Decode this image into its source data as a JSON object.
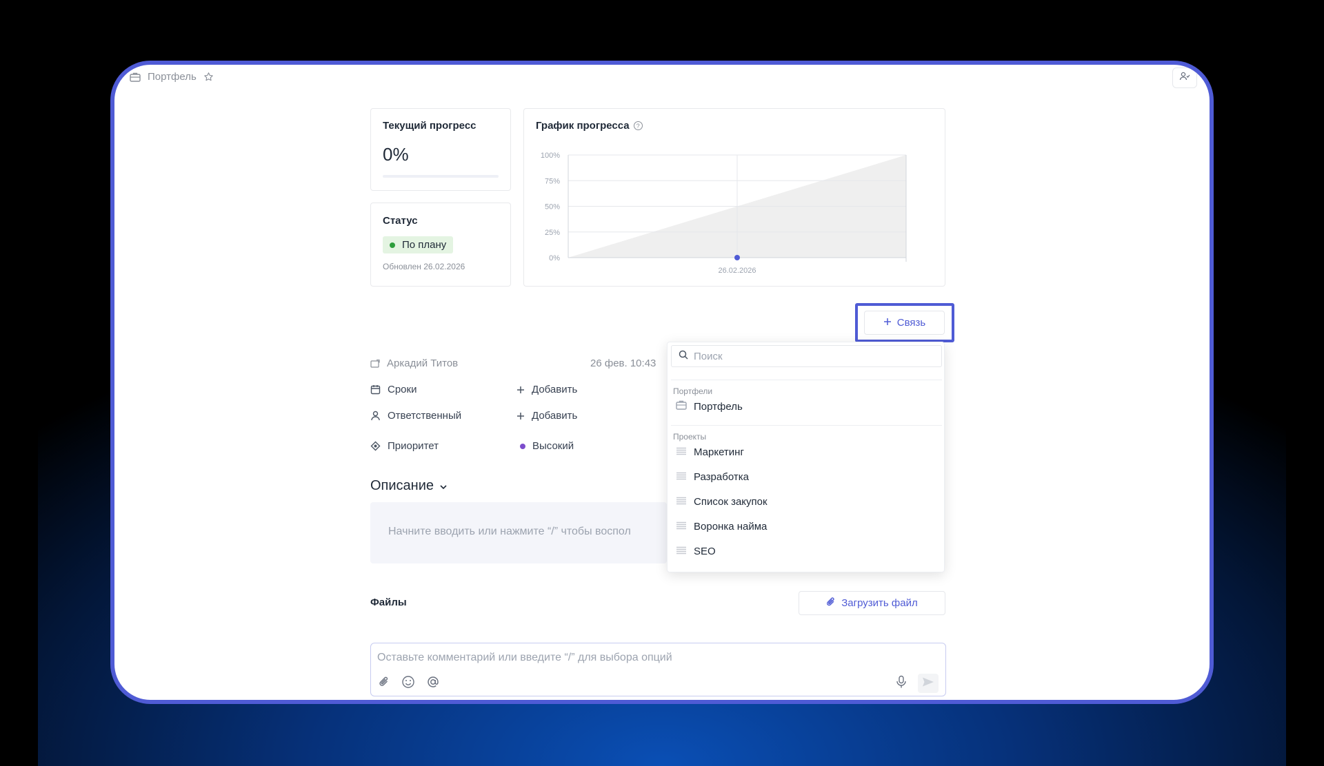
{
  "breadcrumb": {
    "title": "Портфель"
  },
  "progress_card": {
    "title": "Текущий прогресс",
    "value": "0%",
    "progress": 0
  },
  "status_card": {
    "title": "Статус",
    "status": "По плану",
    "updated": "Обновлен 26.02.2026"
  },
  "chart_data": {
    "type": "line",
    "title": "График прогресса",
    "y_ticks": [
      "100%",
      "75%",
      "50%",
      "25%",
      "0%"
    ],
    "ylim": [
      0,
      100
    ],
    "x_ticks": [
      "26.02.2026"
    ],
    "series": [
      {
        "name": "",
        "x": [
          "26.02.2026"
        ],
        "values": [
          0
        ]
      }
    ],
    "grid": true,
    "colors": {
      "plan_area": "#efefef",
      "point": "#4f5bd5"
    }
  },
  "relation_button": {
    "label": "Связь"
  },
  "meta": {
    "author": "Аркадий Титов",
    "timestamp": "26 фев. 10:43",
    "deadline_label": "Сроки",
    "deadline_action": "Добавить",
    "assignee_label": "Ответственный",
    "assignee_action": "Добавить",
    "priority_label": "Приоритет",
    "priority_value": "Высокий"
  },
  "description": {
    "title": "Описание",
    "placeholder": "Начните вводить или нажмите “/” чтобы воспол"
  },
  "files": {
    "title": "Файлы",
    "upload_label": "Загрузить файл"
  },
  "comment": {
    "placeholder": "Оставьте комментарий или введите “/” для выбора опций"
  },
  "dropdown": {
    "search_placeholder": "Поиск",
    "groups": [
      {
        "title": "Портфели",
        "items": [
          {
            "label": "Портфель",
            "icon": "briefcase-icon"
          }
        ]
      },
      {
        "title": "Проекты",
        "items": [
          {
            "label": "Маркетинг",
            "icon": "list-icon"
          },
          {
            "label": "Разработка",
            "icon": "list-icon"
          },
          {
            "label": "Список закупок",
            "icon": "list-icon"
          },
          {
            "label": "Воронка найма",
            "icon": "list-icon"
          },
          {
            "label": "SEO",
            "icon": "list-icon"
          }
        ]
      }
    ]
  },
  "colors": {
    "accent": "#4f5bd5",
    "status_green": "#2e9e3c",
    "priority_purple": "#7c4dcc"
  }
}
